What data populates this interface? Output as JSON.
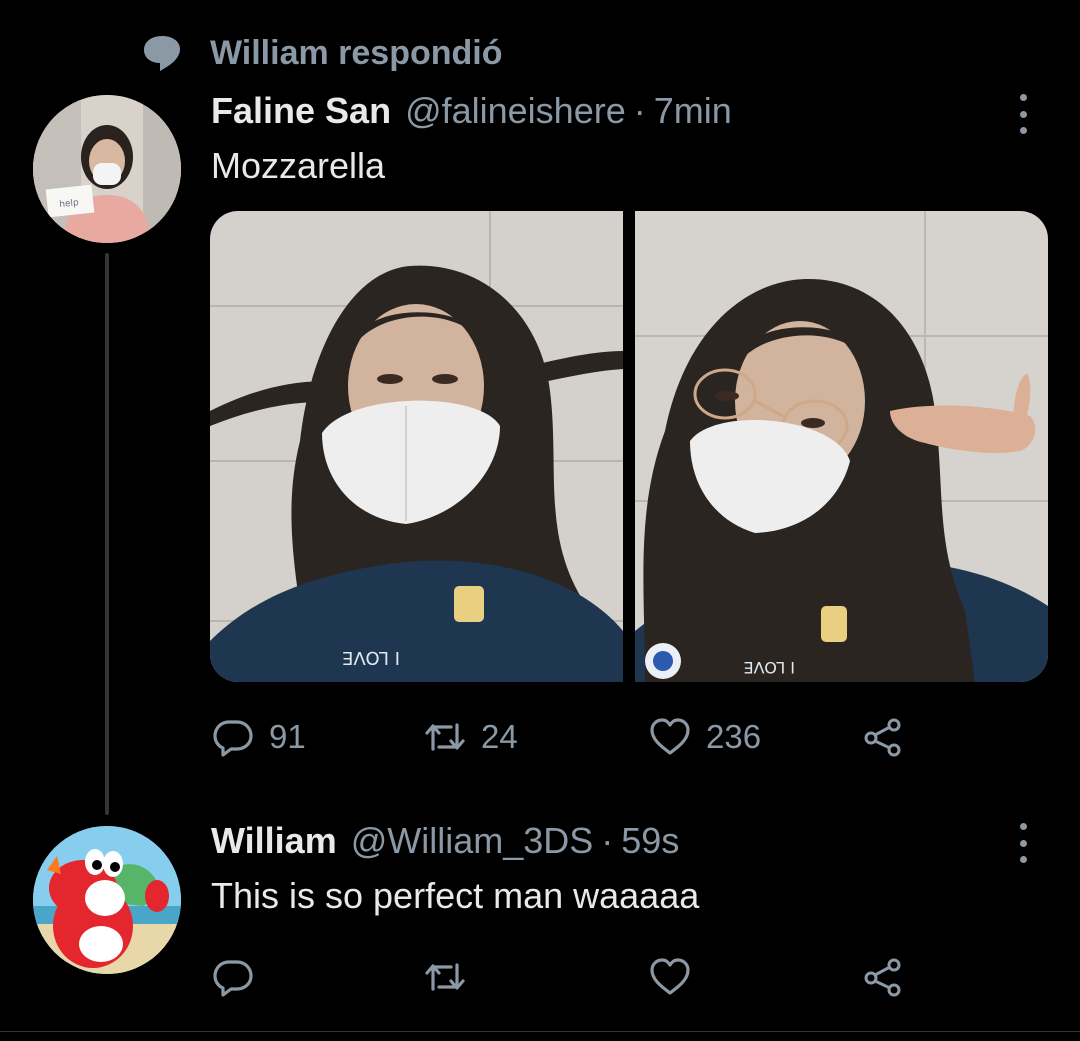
{
  "context": {
    "text": "William respondió",
    "icon": "speech-bubble-icon"
  },
  "tweets": [
    {
      "name": "Faline San",
      "handle": "@falineishere",
      "separator": "·",
      "time": "7min",
      "text": "Mozzarella",
      "avatar_sign_text": "help",
      "photos": [
        {
          "shirt_text": "I LOVE"
        },
        {
          "shirt_text": "I LOVE"
        }
      ],
      "stats": {
        "replies": "91",
        "retweets": "24",
        "likes": "236"
      }
    },
    {
      "name": "William",
      "handle": "@William_3DS",
      "separator": "·",
      "time": "59s",
      "text": "This is so perfect man waaaaa",
      "stats": {
        "replies": "",
        "retweets": "",
        "likes": ""
      }
    }
  ],
  "colors": {
    "background": "#000000",
    "primary_text": "#e7e9ea",
    "secondary_text": "#8b98a5",
    "thread_line": "#333639"
  },
  "icons": [
    "speech-bubble-icon",
    "more-options-icon",
    "reply-icon",
    "retweet-icon",
    "like-icon",
    "share-icon"
  ]
}
